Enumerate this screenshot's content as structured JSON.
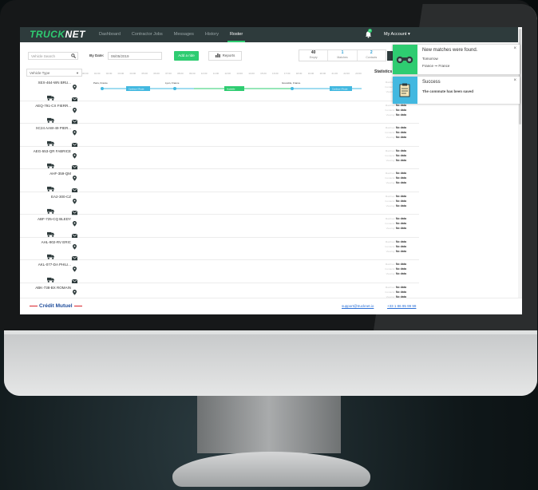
{
  "nav": {
    "logo_main": "TRUCK",
    "logo_accent": "NET",
    "links": [
      "Dashboard",
      "Contractor Jobs",
      "Messages",
      "History",
      "Roster"
    ],
    "active_link": "Roster",
    "notification_count": "2",
    "account": "My Account ▾"
  },
  "toolbar": {
    "search_placeholder": "Vehicle Search",
    "by_date_label": "By Date:",
    "date_value": "06/05/2019",
    "add_ride": "Add a ride",
    "reports": "Reports",
    "stats": [
      {
        "value": "40",
        "label": "Empty"
      },
      {
        "value": "1",
        "label": "Matches"
      },
      {
        "value": "2",
        "label": "Contacts"
      }
    ],
    "vehicle_type": "Vehicle Type"
  },
  "hours": [
    "00:00",
    "01:00",
    "02:00",
    "03:00",
    "04:00",
    "05:00",
    "06:00",
    "07:00",
    "08:00",
    "09:00",
    "10:00",
    "11:00",
    "12:00",
    "13:00",
    "14:00",
    "15:00",
    "16:00",
    "17:00",
    "18:00",
    "19:00",
    "20:00",
    "21:00",
    "22:00",
    "23:00"
  ],
  "statistics_header": "Statistics",
  "row_stat_labels": [
    "Matches:",
    "Contacts:",
    "Viewing:"
  ],
  "row_stat_value": "No data",
  "vehicles": [
    "XEX-464-WN BRU...",
    "AEQ-791-CX FIERR...",
    "XC24 AAW-49 PIER...",
    "AEG-553-QR FABRICE",
    "AHF-359-QM",
    "EA2-300-CZ",
    "ABF-725-CQ BLEDY",
    "AHL-902-RV ERIC",
    "AKL-077-DA PHILI...",
    "ABK-738-BX ROMAIN"
  ],
  "timeline": {
    "labels": [
      "Paris, France",
      "Lyon, France",
      "Grenoble, France"
    ],
    "segments": [
      "Continue / Route",
      "Available",
      "Continue / Route"
    ]
  },
  "footer": {
    "bank": "Crédit Mutuel",
    "support_email": "support@trucknet.io",
    "phone": "+33 1 86 95 99 99"
  },
  "notifications": [
    {
      "title": "New matches were found.",
      "line1": "Tomorrow",
      "from": "France",
      "to": "France"
    },
    {
      "title": "Success",
      "line1": "The commute has been saved"
    }
  ],
  "colors": {
    "brand_green": "#2ecc71",
    "navbar": "#2e3b3c",
    "accent_blue": "#42b8e0"
  }
}
